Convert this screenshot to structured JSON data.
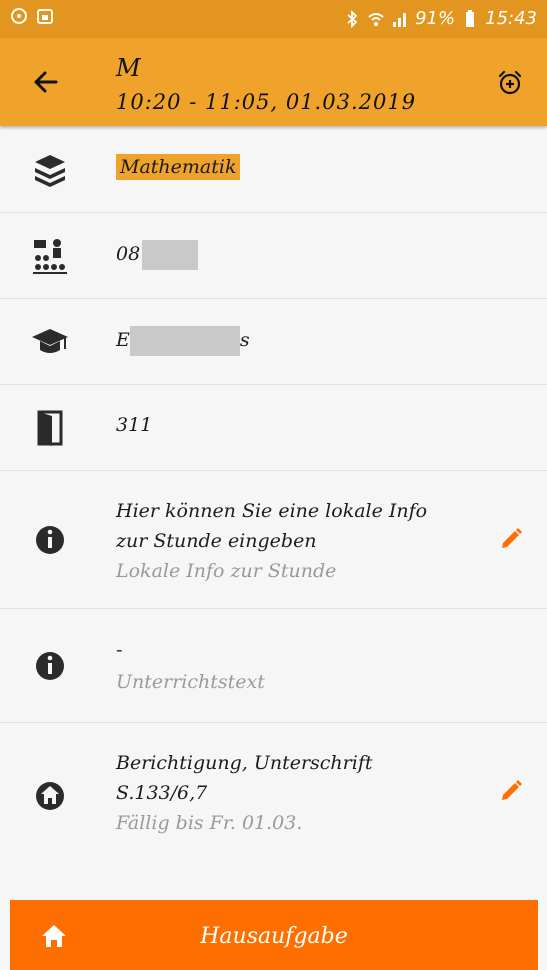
{
  "status_bar": {
    "battery": "91%",
    "time": "15:43",
    "icons": [
      "notification-icon",
      "calendar-icon",
      "bluetooth-icon",
      "wifi-icon",
      "signal-icon",
      "battery-icon"
    ]
  },
  "header": {
    "title": "M",
    "subtitle": "10:20 - 11:05, 01.03.2019",
    "back_icon": "arrow-left-icon",
    "alarm_icon": "alarm-add-icon",
    "color": "#f0a32b"
  },
  "details": {
    "subject": "Mathematik",
    "class": {
      "visible_prefix": "08"
    },
    "teacher": {
      "visible_prefix": "E",
      "visible_suffix": "s"
    },
    "room": "311"
  },
  "local_info": {
    "line1": "Hier können Sie eine lokale Info",
    "line2": "zur Stunde eingeben",
    "label": "Lokale Info zur Stunde"
  },
  "lesson_text": {
    "value": "-",
    "label": "Unterrichtstext"
  },
  "homework": {
    "line1": "Berichtigung, Unterschrift",
    "line2": "S.133/6,7",
    "due": "Fällig bis Fr. 01.03."
  },
  "bottom_bar": {
    "label": "Hausaufgabe",
    "color": "#ff6f00"
  }
}
